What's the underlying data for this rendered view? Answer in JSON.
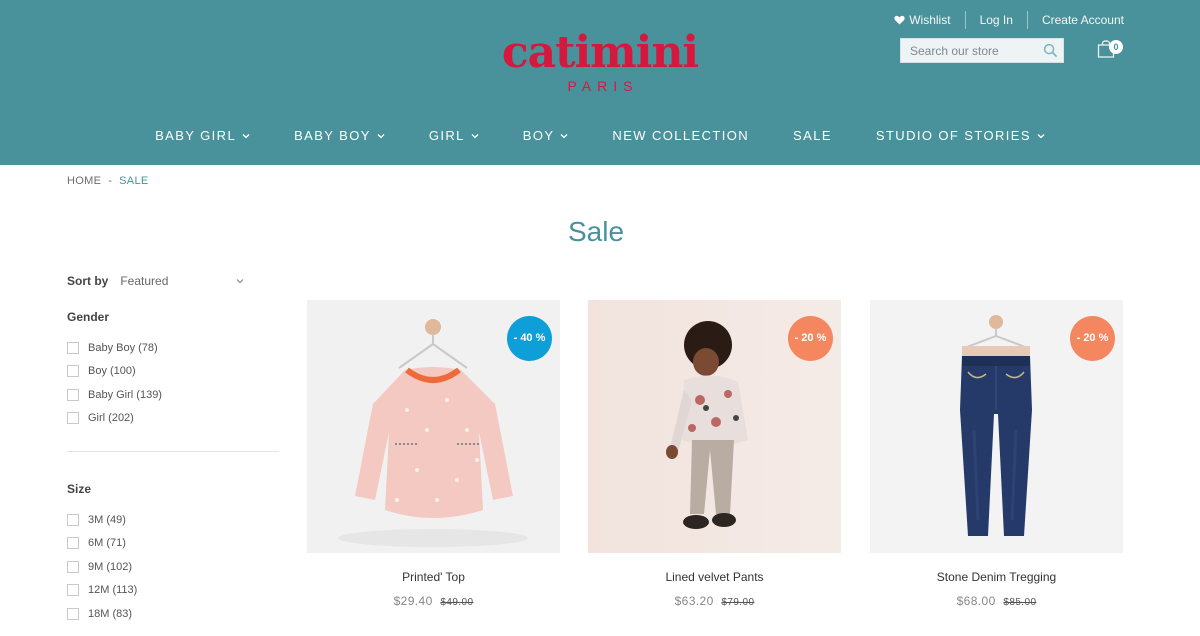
{
  "header": {
    "wishlist_label": "Wishlist",
    "login_label": "Log In",
    "create_account_label": "Create Account",
    "search_placeholder": "Search our store",
    "cart_count": "0",
    "logo_word": "catimini",
    "logo_sub": "PARIS",
    "brand_color": "#d5183e",
    "bar_color": "#4a929b"
  },
  "nav": [
    {
      "label": "BABY GIRL",
      "dropdown": true
    },
    {
      "label": "BABY BOY",
      "dropdown": true
    },
    {
      "label": "GIRL",
      "dropdown": true
    },
    {
      "label": "BOY",
      "dropdown": true
    },
    {
      "label": "NEW COLLECTION",
      "dropdown": false
    },
    {
      "label": "SALE",
      "dropdown": false
    },
    {
      "label": "STUDIO OF STORIES",
      "dropdown": true
    }
  ],
  "breadcrumb": {
    "home": "HOME",
    "separator": "-",
    "current": "SALE"
  },
  "page_title": "Sale",
  "sidebar": {
    "sort_label": "Sort by",
    "sort_value": "Featured",
    "gender": {
      "title": "Gender",
      "options": [
        "Baby Boy (78)",
        "Boy (100)",
        "Baby Girl (139)",
        "Girl (202)"
      ]
    },
    "size": {
      "title": "Size",
      "options": [
        "3M (49)",
        "6M (71)",
        "9M (102)",
        "12M (113)",
        "18M (83)"
      ]
    }
  },
  "products": [
    {
      "name": "Printed' Top",
      "price": "$29.40",
      "old_price": "$49.00",
      "badge": "- 40 %",
      "badge_color": "#0e9fd8"
    },
    {
      "name": "Lined velvet Pants",
      "price": "$63.20",
      "old_price": "$79.00",
      "badge": "- 20 %",
      "badge_color": "#f4875f"
    },
    {
      "name": "Stone Denim Tregging",
      "price": "$68.00",
      "old_price": "$85.00",
      "badge": "- 20 %",
      "badge_color": "#f4875f"
    }
  ]
}
